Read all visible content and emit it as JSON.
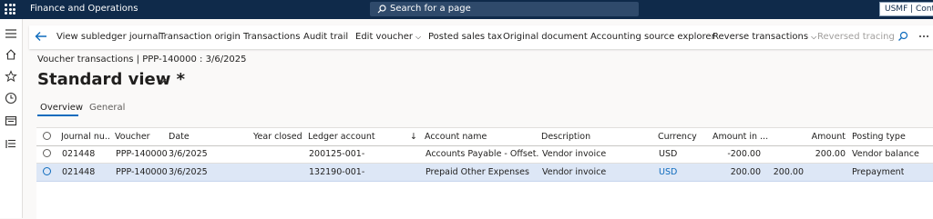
{
  "app": {
    "title": "Finance and Operations",
    "search_placeholder": "Search for a page",
    "company": "USMF | Contoso"
  },
  "actions": {
    "view_subledger_journal": "View subledger journal",
    "transaction_origin": "Transaction origin",
    "transactions": "Transactions",
    "audit_trail": "Audit trail",
    "edit_voucher": "Edit voucher",
    "posted_sales_tax": "Posted sales tax",
    "original_document": "Original document",
    "accounting_source_explorer": "Accounting source explorer",
    "reverse_transactions": "Reverse transactions",
    "reversed_tracing": "Reversed tracing"
  },
  "page": {
    "breadcrumb": "Voucher transactions   |   PPP-140000 : 3/6/2025",
    "view_title": "Standard view *"
  },
  "tabs": {
    "overview": "Overview",
    "general": "General"
  },
  "grid": {
    "columns": {
      "journal": "Journal nu...",
      "voucher": "Voucher",
      "date": "Date",
      "year_closed": "Year closed",
      "ledger_account": "Ledger account",
      "sort_arrow": "↓",
      "account_name": "Account name",
      "description": "Description",
      "currency": "Currency",
      "amount_in": "Amount in ...",
      "amount": "Amount",
      "posting_type": "Posting type"
    },
    "rows": [
      {
        "journal": "021448",
        "voucher": "PPP-140000",
        "date": "3/6/2025",
        "year_closed": "",
        "ledger_account": "200125-001-",
        "account_name": "Accounts Payable - Offset...",
        "description": "Vendor invoice",
        "currency": "USD",
        "amount_in": "-200.00",
        "extra": "",
        "amount": "200.00",
        "posting_type": "Vendor balance"
      },
      {
        "journal": "021448",
        "voucher": "PPP-140000",
        "date": "3/6/2025",
        "year_closed": "",
        "ledger_account": "132190-001-",
        "account_name": "Prepaid Other Expenses",
        "description": "Vendor invoice",
        "currency": "USD",
        "amount_in": "200.00",
        "extra": "200.00",
        "amount": "",
        "posting_type": "Prepayment"
      }
    ]
  },
  "colors": {
    "topbar": "#0f2a4a",
    "accent": "#0f6cbd",
    "selected_row": "#dde7f6"
  }
}
